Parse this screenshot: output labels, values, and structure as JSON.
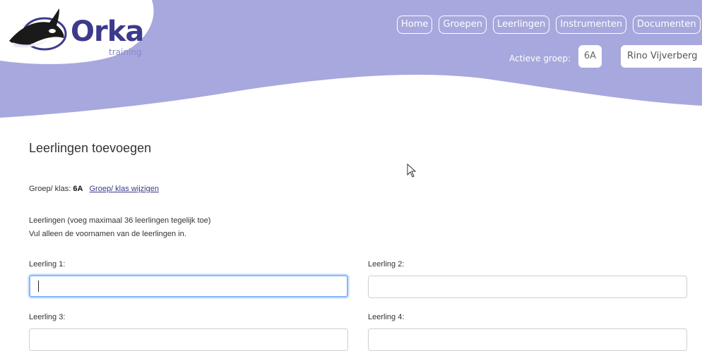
{
  "brand": {
    "name": "Orka",
    "sub": "training"
  },
  "nav": [
    "Home",
    "Groepen",
    "Leerlingen",
    "Instrumenten",
    "Documenten"
  ],
  "header": {
    "active_label": "Actieve groep:",
    "active_group": "6A",
    "user": "Rino Vijverberg"
  },
  "page": {
    "title": "Leerlingen toevoegen",
    "group_prefix": "Groep/ klas:",
    "group_value": "6A",
    "group_change_link": "Groep/ klas wijzigen",
    "info_line1": "Leerlingen (voeg maximaal 36 leerlingen tegelijk toe)",
    "info_line2": "Vul alleen de voornamen van de leerlingen in."
  },
  "students": [
    {
      "label": "Leerling 1:",
      "value": ""
    },
    {
      "label": "Leerling 2:",
      "value": ""
    },
    {
      "label": "Leerling 3:",
      "value": ""
    },
    {
      "label": "Leerling 4:",
      "value": ""
    }
  ],
  "colors": {
    "header_bg": "#a7a8dd",
    "brand": "#3c3a8c",
    "focus": "#86b7fe"
  }
}
